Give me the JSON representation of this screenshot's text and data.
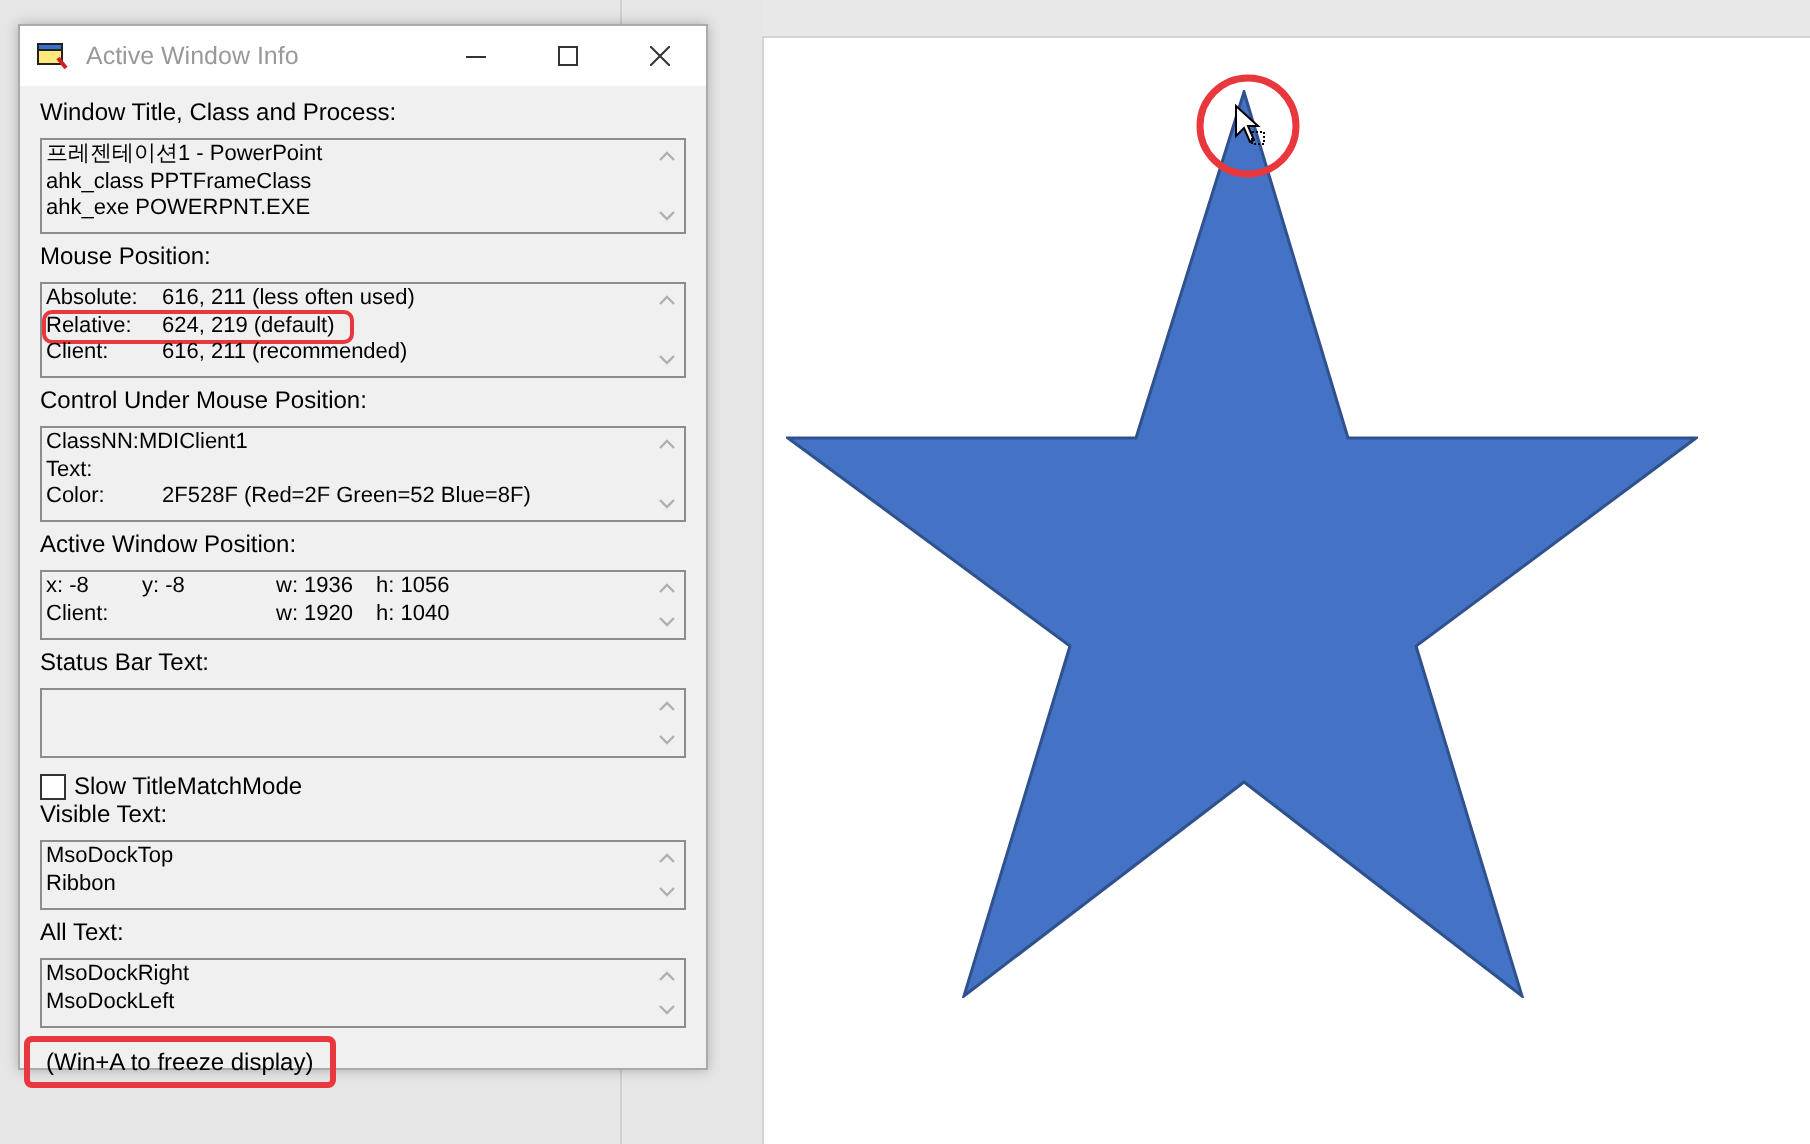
{
  "window": {
    "title": "Active Window Info"
  },
  "sections": [
    {
      "label": "Window Title, Class and Process:",
      "lines": [
        {
          "cells": [
            "프레젠테이션1 - PowerPoint"
          ],
          "highlighted": false
        },
        {
          "cells": [
            "ahk_class PPTFrameClass"
          ],
          "highlighted": false
        },
        {
          "cells": [
            "ahk_exe POWERPNT.EXE"
          ],
          "highlighted": false
        }
      ]
    },
    {
      "label": "Mouse Position:",
      "lines": [
        {
          "cells": [
            "Absolute:",
            "616, 211 (less often used)"
          ],
          "highlighted": false
        },
        {
          "cells": [
            "Relative:",
            "624, 219 (default)"
          ],
          "highlighted": true
        },
        {
          "cells": [
            "Client:",
            "616, 211 (recommended)"
          ],
          "highlighted": false
        }
      ]
    },
    {
      "label": "Control Under Mouse Position:",
      "lines": [
        {
          "cells": [
            "ClassNN:MDIClient1"
          ],
          "highlighted": false
        },
        {
          "cells": [
            "Text:"
          ],
          "highlighted": false
        },
        {
          "cells": [
            "Color:",
            "2F528F (Red=2F Green=52 Blue=8F)"
          ],
          "highlighted": false
        }
      ]
    },
    {
      "label": "Active Window Position:",
      "lines": [
        {
          "cells": [
            "x: -8",
            "y: -8",
            "w: 1936",
            "h: 1056"
          ],
          "highlighted": false
        },
        {
          "cells": [
            "Client:",
            null,
            "w: 1920",
            "h: 1040"
          ],
          "highlighted": false
        }
      ]
    },
    {
      "label": "Status Bar Text:"
    }
  ],
  "checkbox": {
    "label": "Slow TitleMatchMode",
    "checked": false
  },
  "text_sections": [
    {
      "label": "Visible Text:",
      "lines": [
        {
          "cells": [
            "MsoDockTop"
          ],
          "highlighted": false
        },
        {
          "cells": [
            "Ribbon"
          ],
          "highlighted": false
        }
      ]
    },
    {
      "label": "All Text:",
      "lines": [
        {
          "cells": [
            "MsoDockRight"
          ],
          "highlighted": false
        },
        {
          "cells": [
            "MsoDockLeft"
          ],
          "highlighted": false
        }
      ]
    }
  ],
  "footer": {
    "text": "(Win+A to freeze display)",
    "highlighted": true
  }
}
